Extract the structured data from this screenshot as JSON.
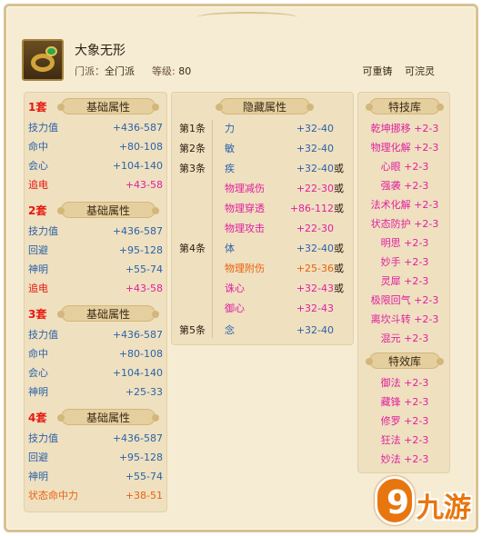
{
  "header": {
    "item_name": "大象无形",
    "school_label": "门派：",
    "school_value": "全门派",
    "level_label": "等级:",
    "level_value": "80",
    "reforge_label": "可重铸",
    "wash_label": "可浣灵"
  },
  "base_attrs": {
    "banner": "基础属性",
    "sets": [
      {
        "label": "1套",
        "rows": [
          {
            "name": "技力值",
            "value": "+436-587"
          },
          {
            "name": "命中",
            "value": "+80-108"
          },
          {
            "name": "会心",
            "value": "+104-140"
          },
          {
            "name": "追电",
            "value": "+43-58"
          }
        ]
      },
      {
        "label": "2套",
        "rows": [
          {
            "name": "技力值",
            "value": "+436-587"
          },
          {
            "name": "回避",
            "value": "+95-128"
          },
          {
            "name": "神明",
            "value": "+55-74"
          },
          {
            "name": "追电",
            "value": "+43-58"
          }
        ]
      },
      {
        "label": "3套",
        "rows": [
          {
            "name": "技力值",
            "value": "+436-587"
          },
          {
            "name": "命中",
            "value": "+80-108"
          },
          {
            "name": "会心",
            "value": "+104-140"
          },
          {
            "name": "神明",
            "value": "+25-33"
          }
        ]
      },
      {
        "label": "4套",
        "rows": [
          {
            "name": "技力值",
            "value": "+436-587"
          },
          {
            "name": "回避",
            "value": "+95-128"
          },
          {
            "name": "神明",
            "value": "+55-74"
          },
          {
            "name": "状态命中力",
            "value": "+38-51"
          }
        ]
      }
    ]
  },
  "hidden_attrs": {
    "banner": "隐藏属性",
    "rows": [
      {
        "label": "第1条",
        "name": "力",
        "value": "+32-40",
        "or": ""
      },
      {
        "label": "第2条",
        "name": "敏",
        "value": "+32-40",
        "or": ""
      },
      {
        "label": "第3条",
        "name": "疾",
        "value": "+32-40",
        "or": "或"
      },
      {
        "label": "",
        "name": "物理减伤",
        "value": "+22-30",
        "or": "或"
      },
      {
        "label": "",
        "name": "物理穿透",
        "value": "+86-112",
        "or": "或"
      },
      {
        "label": "",
        "name": "物理攻击",
        "value": "+22-30",
        "or": ""
      },
      {
        "label": "第4条",
        "name": "体",
        "value": "+32-40",
        "or": "或"
      },
      {
        "label": "",
        "name": "物理附伤",
        "value": "+25-36",
        "or": "或"
      },
      {
        "label": "",
        "name": "诛心",
        "value": "+32-43",
        "or": "或"
      },
      {
        "label": "",
        "name": "御心",
        "value": "+32-43",
        "or": ""
      },
      {
        "label": "第5条",
        "name": "念",
        "value": "+32-40",
        "or": ""
      }
    ]
  },
  "skill_library": {
    "title": "特技库",
    "items": [
      "乾坤挪移 +2-3",
      "物理化解 +2-3",
      "心眼 +2-3",
      "强袭 +2-3",
      "法术化解 +2-3",
      "状态防护 +2-3",
      "明思 +2-3",
      "妙手 +2-3",
      "灵犀 +2-3",
      "极限回气 +2-3",
      "离坎斗转 +2-3",
      "混元 +2-3"
    ]
  },
  "effect_library": {
    "title": "特效库",
    "items": [
      "御法 +2-3",
      "藏锋 +2-3",
      "修罗 +2-3",
      "狂法 +2-3",
      "妙法 +2-3"
    ]
  },
  "watermark": {
    "glyph": "9",
    "text": "九游"
  },
  "colors": {
    "set_label": "#e8170f",
    "blue": "#2b63a8",
    "magenta": "#e0209e",
    "orange": "#e8630f"
  }
}
